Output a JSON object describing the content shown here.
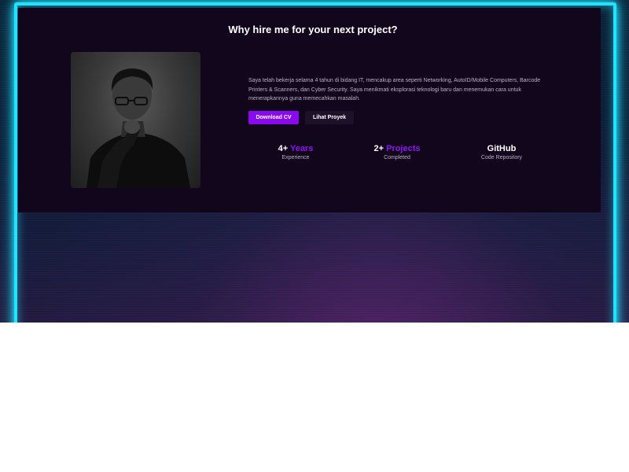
{
  "hero": {
    "title": "Why hire me for your next project?",
    "photo": "portrait-photo",
    "description": "Saya telah bekerja selama 4 tahun di bidang IT, mencakup area seperti Networking, AutoID/Mobile Computers, Barcode Printers & Scanners, dan Cyber Security. Saya menikmati eksplorasi teknologi baru dan menemukan cara untuk menerapkannya guna memecahkan masalah.",
    "buttons": {
      "download_cv": "Download CV",
      "projects": "Lihat Proyek"
    },
    "stats": [
      {
        "number": "4+",
        "accent": "Years",
        "label": "Experience"
      },
      {
        "number": "2+",
        "accent": "Projects",
        "label": "Completed"
      },
      {
        "number": "GitHub",
        "accent": "",
        "label": "Code Repository"
      }
    ]
  },
  "colors": {
    "neon_border": "#22e3ff",
    "accent_purple": "#8a0af0",
    "panel_bg": "#11061c"
  }
}
